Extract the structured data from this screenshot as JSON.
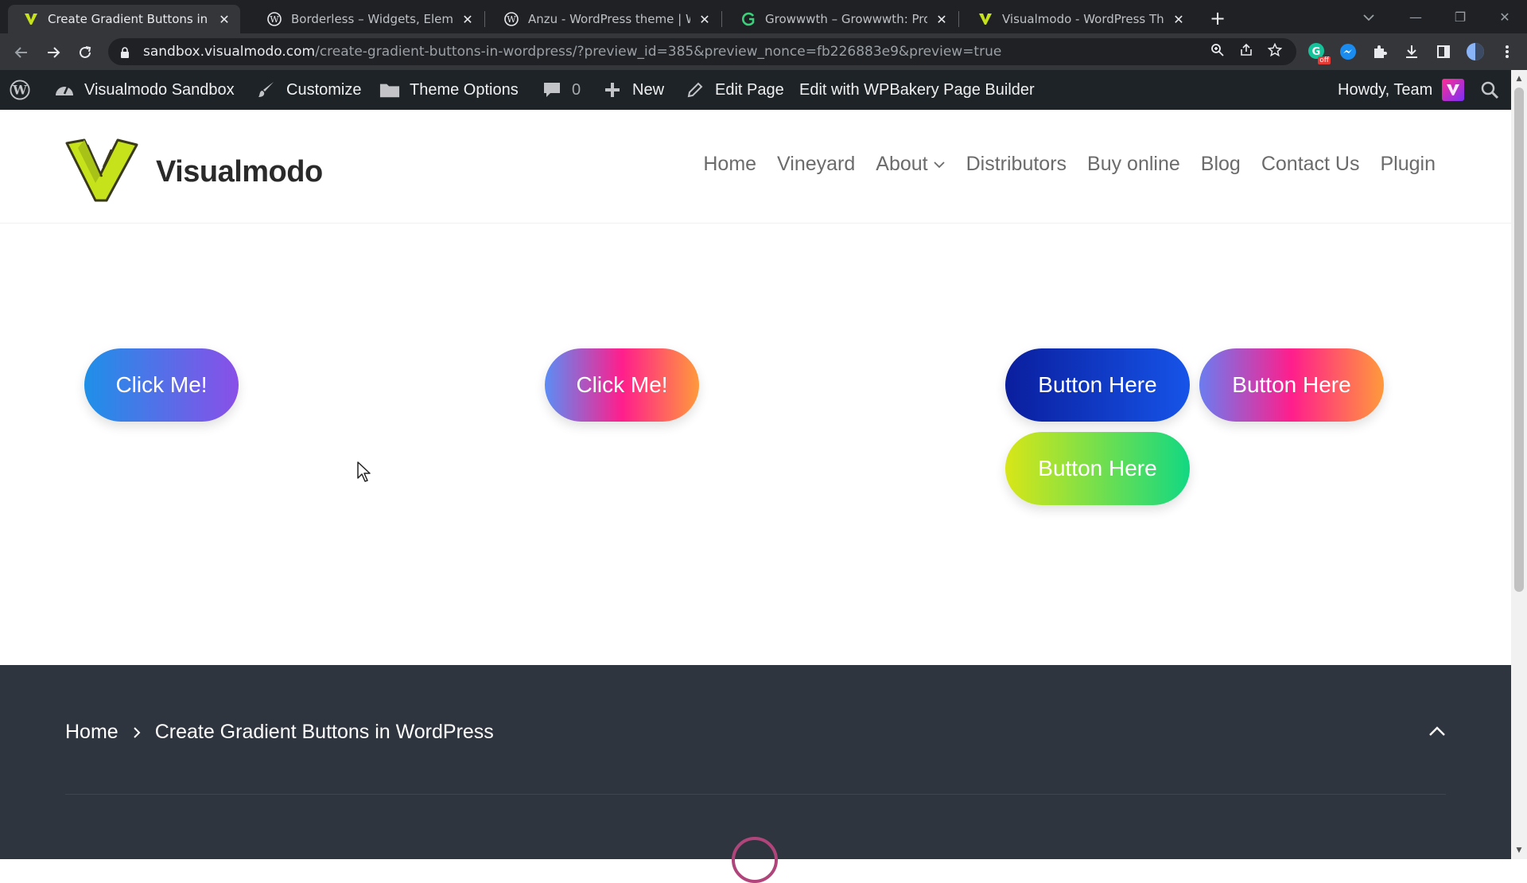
{
  "browser": {
    "tabs": [
      {
        "title": "Create Gradient Buttons in WordPress",
        "icon": "visualmodo-favicon"
      },
      {
        "title": "Borderless – Widgets, Elements, Templates",
        "icon": "wordpress-favicon"
      },
      {
        "title": "Anzu - WordPress theme | WordPress",
        "icon": "wordpress-favicon"
      },
      {
        "title": "Growwwth – Growwwth: Program",
        "icon": "growwwth-favicon"
      },
      {
        "title": "Visualmodo - WordPress Themes",
        "icon": "visualmodo-favicon"
      }
    ],
    "url_domain": "sandbox.visualmodo.com",
    "url_path": "/create-gradient-buttons-in-wordpress/?preview_id=385&preview_nonce=fb226883e9&preview=true",
    "extension_badge": "off"
  },
  "adminbar": {
    "site_name": "Visualmodo Sandbox",
    "customize": "Customize",
    "theme_options": "Theme Options",
    "comments_count": "0",
    "new": "New",
    "edit_page": "Edit Page",
    "wpbakery": "Edit with WPBakery Page Builder",
    "howdy": "Howdy, Team"
  },
  "site": {
    "brand": "Visualmodo",
    "nav": [
      "Home",
      "Vineyard",
      "About",
      "Distributors",
      "Buy online",
      "Blog",
      "Contact Us",
      "Plugin"
    ]
  },
  "buttons": [
    {
      "label": "Click Me!",
      "colors": [
        "#1e90e8",
        "#8a4fe8"
      ]
    },
    {
      "label": "Click Me!",
      "colors": [
        "#5b8df5",
        "#ff1e8c",
        "#ff9a3c"
      ]
    },
    {
      "label": "Button Here",
      "colors": [
        "#0a1e9e",
        "#1654e8"
      ]
    },
    {
      "label": "Button Here",
      "colors": [
        "#6b7cf0",
        "#ff1e8c",
        "#ff9a3c"
      ]
    },
    {
      "label": "Button Here",
      "colors": [
        "#d8e617",
        "#12d882"
      ]
    }
  ],
  "footer": {
    "breadcrumb_home": "Home",
    "breadcrumb_current": "Create Gradient Buttons in WordPress"
  },
  "colors": {
    "adminbar_bg": "#1d2327",
    "footer_bg": "#2f353f",
    "brand_logo": "#c6e21b"
  }
}
